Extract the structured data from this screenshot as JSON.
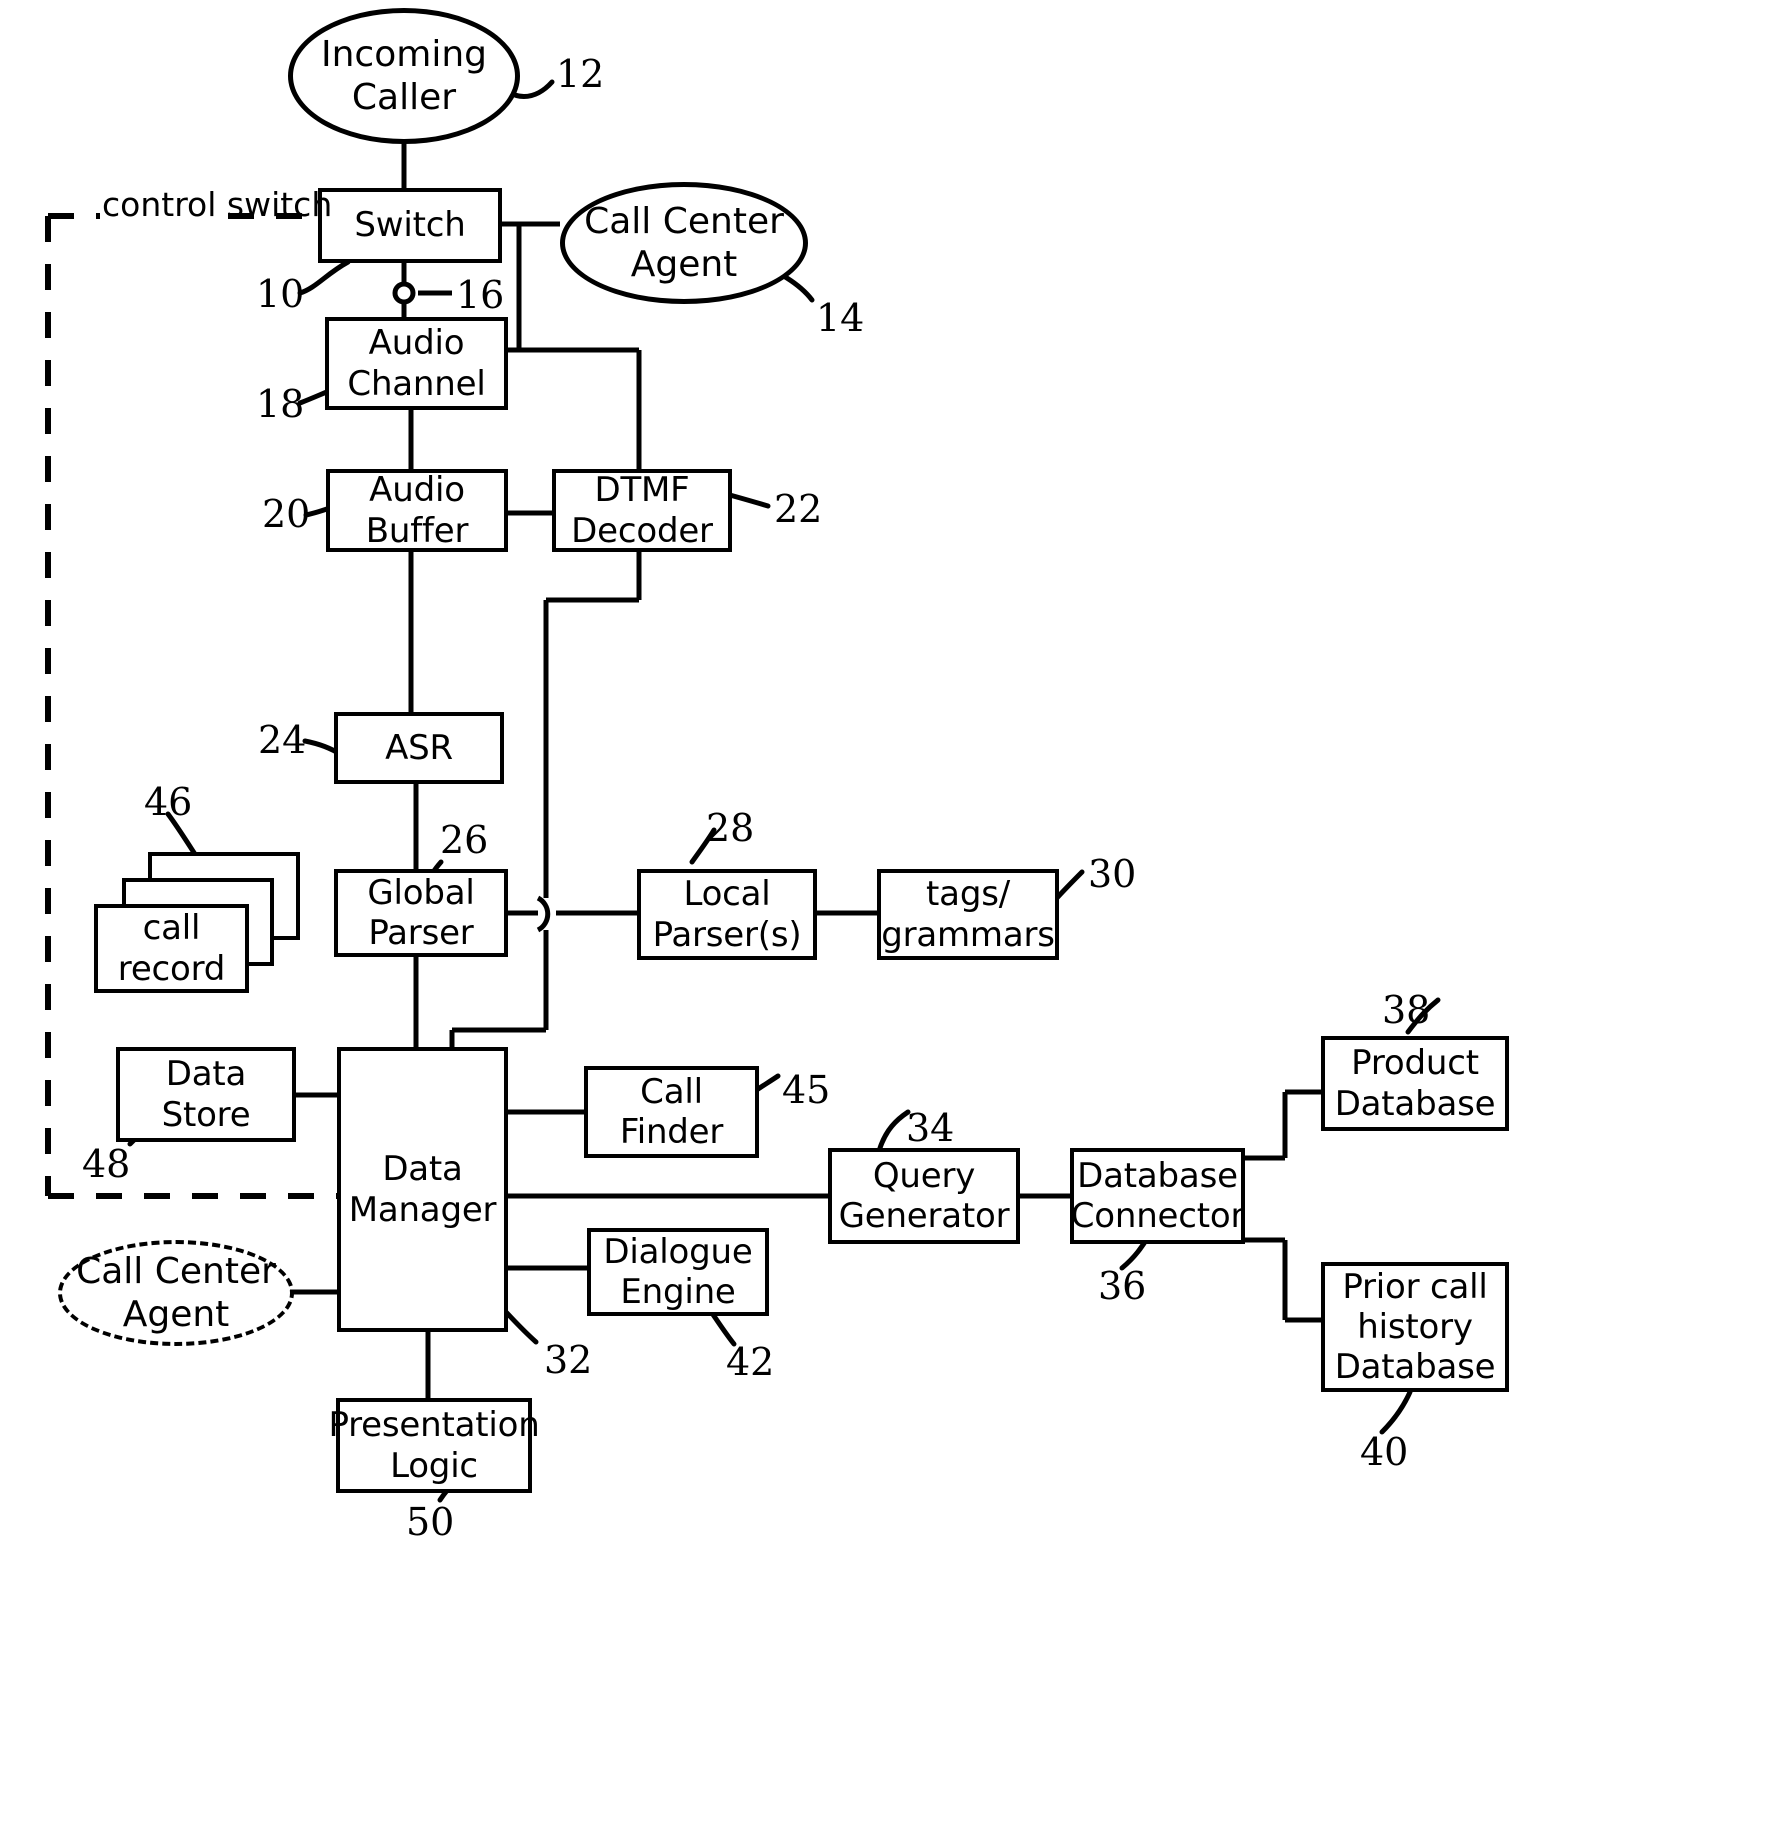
{
  "figure": {
    "type": "patent-block-diagram",
    "boundary_label": "control switch",
    "boundary_style": "dashed"
  },
  "nodes": [
    {
      "id": "incoming-caller",
      "label": "Incoming\nCaller",
      "shape": "ellipse",
      "ref": "12"
    },
    {
      "id": "switch",
      "label": "Switch",
      "shape": "rect",
      "ref": "10"
    },
    {
      "id": "call-center-agent-top",
      "label": "Call Center\nAgent",
      "shape": "ellipse",
      "ref": "14"
    },
    {
      "id": "audio-channel",
      "label": "Audio\nChannel",
      "shape": "rect",
      "ref": "18"
    },
    {
      "id": "switch-tap",
      "label": "",
      "shape": "junction",
      "ref": "16"
    },
    {
      "id": "audio-buffer",
      "label": "Audio\nBuffer",
      "shape": "rect",
      "ref": "20"
    },
    {
      "id": "dtmf-decoder",
      "label": "DTMF\nDecoder",
      "shape": "rect",
      "ref": "22"
    },
    {
      "id": "asr",
      "label": "ASR",
      "shape": "rect",
      "ref": "24"
    },
    {
      "id": "global-parser",
      "label": "Global\nParser",
      "shape": "rect",
      "ref": "26"
    },
    {
      "id": "local-parsers",
      "label": "Local\nParser(s)",
      "shape": "rect",
      "ref": "28"
    },
    {
      "id": "tags-grammars",
      "label": "tags/\ngrammars",
      "shape": "rect",
      "ref": "30"
    },
    {
      "id": "call-record",
      "label": "call\nrecord",
      "shape": "rect-stack",
      "ref": "46"
    },
    {
      "id": "data-store",
      "label": "Data\nStore",
      "shape": "rect",
      "ref": "48"
    },
    {
      "id": "data-manager",
      "label": "Data\nManager",
      "shape": "rect",
      "ref": "32"
    },
    {
      "id": "call-finder",
      "label": "Call\nFinder",
      "shape": "rect",
      "ref": "45"
    },
    {
      "id": "dialogue-engine",
      "label": "Dialogue\nEngine",
      "shape": "rect",
      "ref": "42"
    },
    {
      "id": "query-generator",
      "label": "Query\nGenerator",
      "shape": "rect",
      "ref": "34"
    },
    {
      "id": "database-connector",
      "label": "Database\nConnector",
      "shape": "rect",
      "ref": "36"
    },
    {
      "id": "product-database",
      "label": "Product\nDatabase",
      "shape": "rect",
      "ref": "38"
    },
    {
      "id": "prior-call-history-database",
      "label": "Prior call\nhistory\nDatabase",
      "shape": "rect",
      "ref": "40"
    },
    {
      "id": "presentation-logic",
      "label": "Presentation\nLogic",
      "shape": "rect",
      "ref": "50"
    },
    {
      "id": "call-center-agent-bottom",
      "label": "Call Center\nAgent",
      "shape": "ellipse-dashed",
      "ref": ""
    }
  ],
  "labels": {
    "incoming_caller_l1": "Incoming",
    "incoming_caller_l2": "Caller",
    "switch": "Switch",
    "agent_top_l1": "Call Center",
    "agent_top_l2": "Agent",
    "audio_channel_l1": "Audio",
    "audio_channel_l2": "Channel",
    "audio_buffer_l1": "Audio",
    "audio_buffer_l2": "Buffer",
    "dtmf_l1": "DTMF",
    "dtmf_l2": "Decoder",
    "asr": "ASR",
    "global_parser_l1": "Global",
    "global_parser_l2": "Parser",
    "local_parsers_l1": "Local",
    "local_parsers_l2": "Parser(s)",
    "tags_l1": "tags/",
    "tags_l2": "grammars",
    "call_record_l1": "call",
    "call_record_l2": "record",
    "data_store_l1": "Data",
    "data_store_l2": "Store",
    "data_manager_l1": "Data",
    "data_manager_l2": "Manager",
    "call_finder_l1": "Call",
    "call_finder_l2": "Finder",
    "dialogue_engine_l1": "Dialogue",
    "dialogue_engine_l2": "Engine",
    "query_generator_l1": "Query",
    "query_generator_l2": "Generator",
    "database_connector_l1": "Database",
    "database_connector_l2": "Connector",
    "product_database_l1": "Product",
    "product_database_l2": "Database",
    "prior_db_l1": "Prior call",
    "prior_db_l2": "history",
    "prior_db_l3": "Database",
    "presentation_logic_l1": "Presentation",
    "presentation_logic_l2": "Logic",
    "agent_bottom_l1": "Call Center",
    "agent_bottom_l2": "Agent",
    "boundary_l1": "control",
    "boundary_l2": "switch"
  },
  "reference_numerals": {
    "r10": "10",
    "r12": "12",
    "r14": "14",
    "r16": "16",
    "r18": "18",
    "r20": "20",
    "r22": "22",
    "r24": "24",
    "r26": "26",
    "r28": "28",
    "r30": "30",
    "r32": "32",
    "r34": "34",
    "r36": "36",
    "r38": "38",
    "r40": "40",
    "r42": "42",
    "r45": "45",
    "r46": "46",
    "r48": "48",
    "r50": "50"
  },
  "colors": {
    "ink": "#000000",
    "paper": "#ffffff"
  }
}
